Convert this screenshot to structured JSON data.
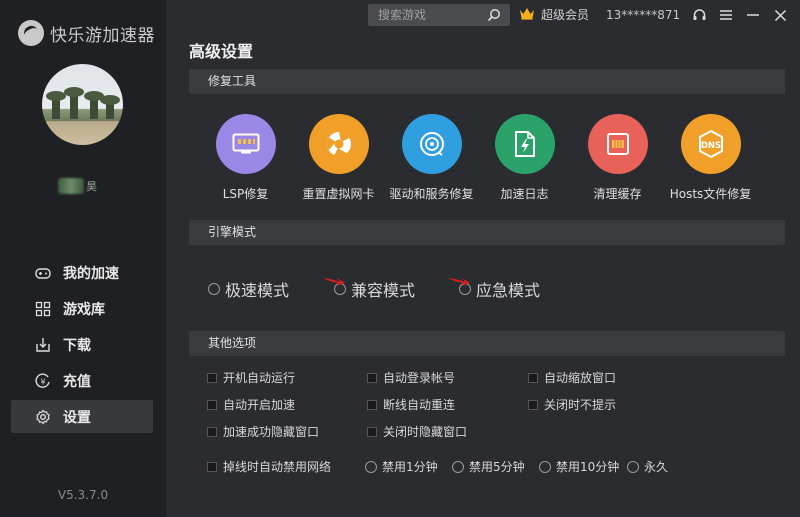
{
  "app": {
    "name": "快乐游加速器",
    "version": "V5.3.7.0"
  },
  "user": {
    "name_fragment": "昊",
    "vip_label": "超级会员",
    "phone": "13******871"
  },
  "search": {
    "placeholder": "搜索游戏"
  },
  "nav": [
    {
      "label": "我的加速",
      "icon": "gamepad-icon",
      "active": false
    },
    {
      "label": "游戏库",
      "icon": "grid-icon",
      "active": false
    },
    {
      "label": "下载",
      "icon": "download-icon",
      "active": false
    },
    {
      "label": "充值",
      "icon": "recharge-icon",
      "active": false
    },
    {
      "label": "设置",
      "icon": "gear-icon",
      "active": true
    }
  ],
  "page": {
    "title": "高级设置"
  },
  "sections": {
    "repair": "修复工具",
    "engine": "引擎模式",
    "other": "其他选项"
  },
  "tools": [
    {
      "label": "LSP修复",
      "color": "#9b87e6",
      "icon": "lsp-icon"
    },
    {
      "label": "重置虚拟网卡",
      "color": "#f0a028",
      "icon": "network-card-icon"
    },
    {
      "label": "驱动和服务修复",
      "color": "#2f9fe0",
      "icon": "driver-icon"
    },
    {
      "label": "加速日志",
      "color": "#2aa26a",
      "icon": "log-icon"
    },
    {
      "label": "清理缓存",
      "color": "#e8625a",
      "icon": "cache-icon"
    },
    {
      "label": "Hosts文件修复",
      "color": "#f0a028",
      "icon": "dns-icon"
    }
  ],
  "engine_modes": [
    {
      "label": "极速模式",
      "selected": false
    },
    {
      "label": "兼容模式",
      "selected": false
    },
    {
      "label": "应急模式",
      "selected": false
    }
  ],
  "options": [
    {
      "label": "开机自动运行",
      "checked": false
    },
    {
      "label": "自动登录帐号",
      "checked": false
    },
    {
      "label": "自动缩放窗口",
      "checked": false
    },
    {
      "label": "自动开启加速",
      "checked": false
    },
    {
      "label": "断线自动重连",
      "checked": false
    },
    {
      "label": "关闭时不提示",
      "checked": false
    },
    {
      "label": "加速成功隐藏窗口",
      "checked": false
    },
    {
      "label": "关闭时隐藏窗口",
      "checked": false
    }
  ],
  "disconnect": {
    "label": "掉线时自动禁用网络",
    "checked": false,
    "choices": [
      "禁用1分钟",
      "禁用5分钟",
      "禁用10分钟",
      "永久"
    ]
  },
  "colors": {
    "accent_arrow": "#e01e1e",
    "vip_crown": "#f2b01e"
  }
}
